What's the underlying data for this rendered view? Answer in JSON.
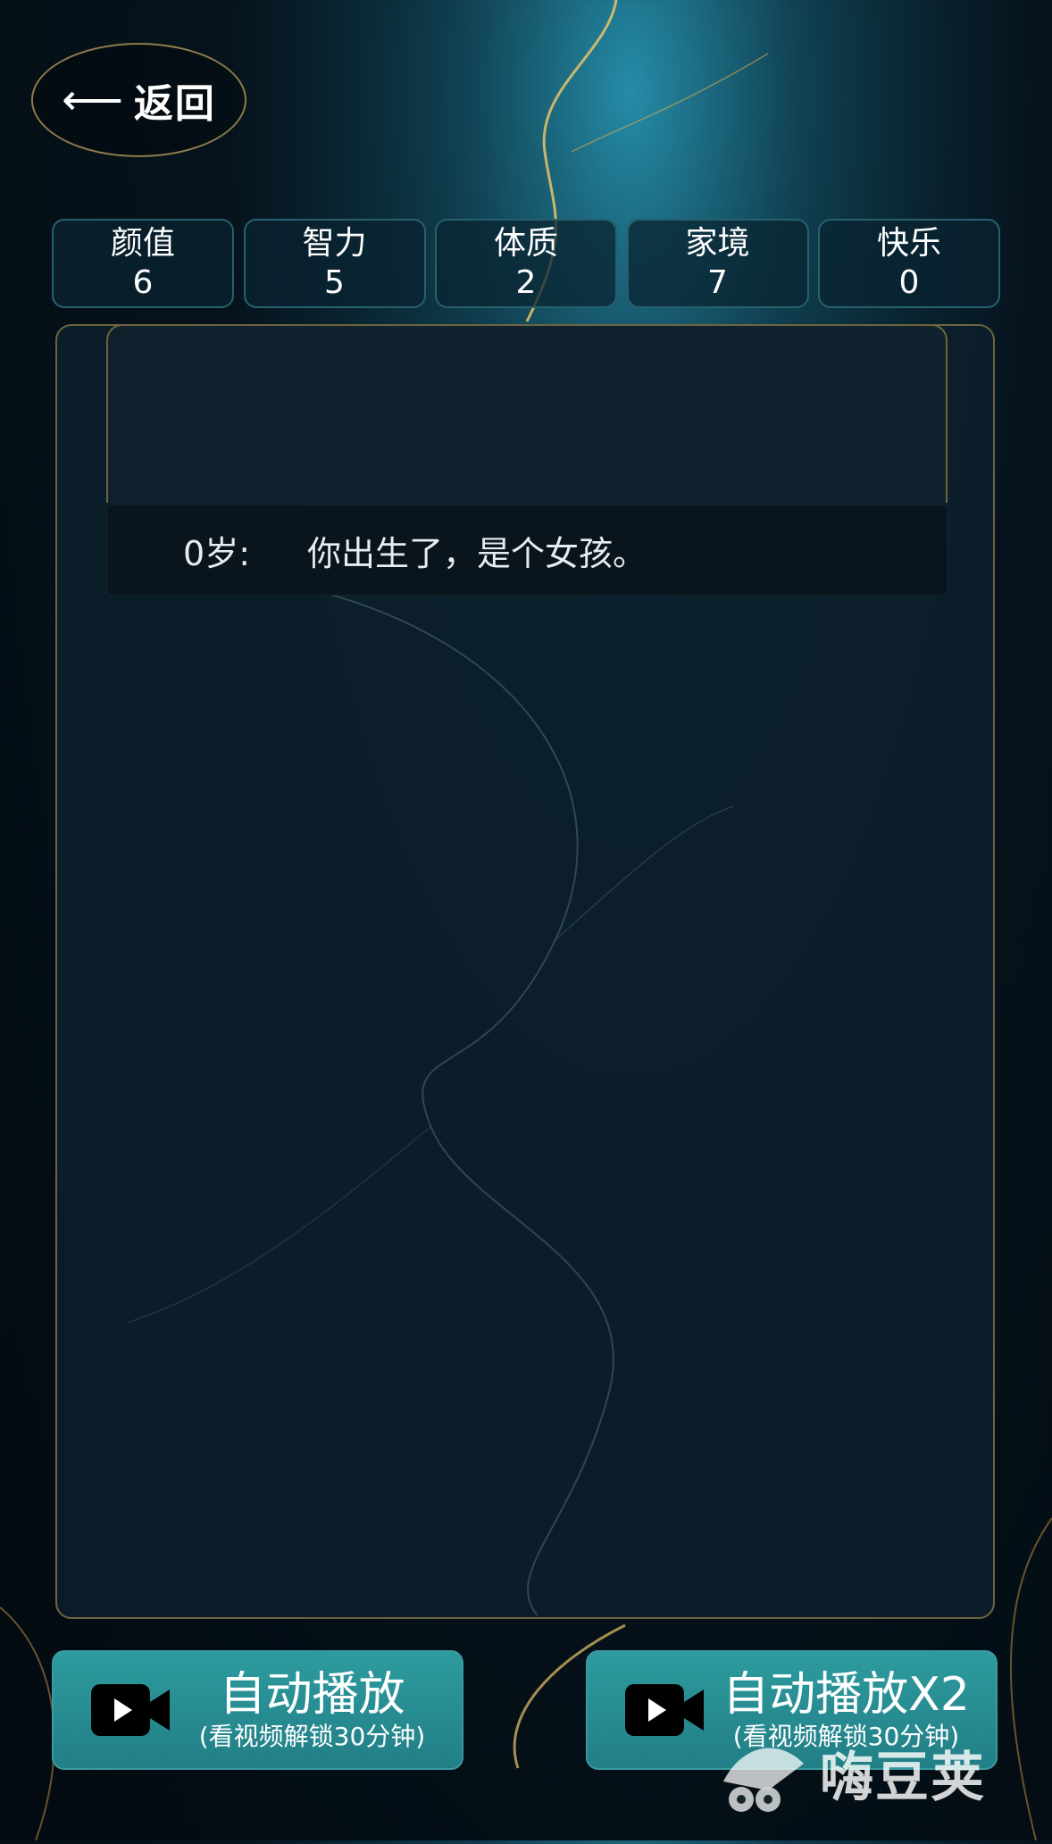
{
  "header": {
    "back_label": "返回"
  },
  "stats": [
    {
      "label": "颜值",
      "value": "6"
    },
    {
      "label": "智力",
      "value": "5"
    },
    {
      "label": "体质",
      "value": "2"
    },
    {
      "label": "家境",
      "value": "7"
    },
    {
      "label": "快乐",
      "value": "0"
    }
  ],
  "events": [
    {
      "age": "0岁:",
      "text": "你出生了，是个女孩。"
    }
  ],
  "buttons": {
    "auto_play": {
      "label": "自动播放",
      "sub": "(看视频解锁30分钟)"
    },
    "auto_play_x2": {
      "label": "自动播放X2",
      "sub": "(看视频解锁30分钟)"
    }
  },
  "watermark": {
    "text": "嗨豆荚"
  },
  "colors": {
    "accent_button": "#2d9b9f",
    "panel_border": "#6d6441",
    "stat_border": "#27606d"
  },
  "icons": [
    "back-arrow-icon",
    "video-camera-icon",
    "watermark-logo-icon"
  ]
}
